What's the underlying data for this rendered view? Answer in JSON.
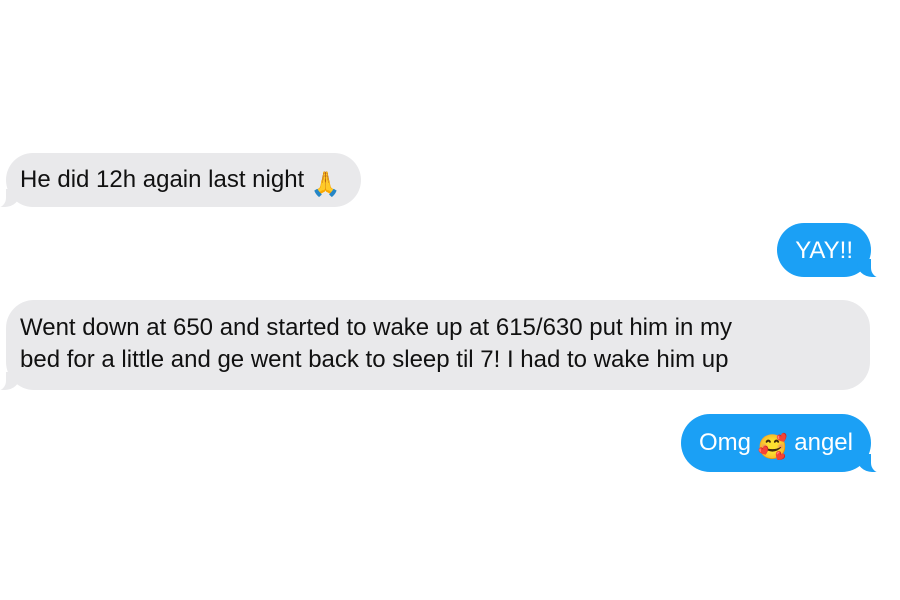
{
  "messages": [
    {
      "direction": "incoming",
      "text": "He did 12h again last night",
      "emoji": "🙏",
      "emoji_name": "folded-hands-icon"
    },
    {
      "direction": "outgoing",
      "text": "YAY!!"
    },
    {
      "direction": "incoming",
      "line1": "Went down at 650 and started to wake up at 615/630 put him in my",
      "line2": "bed for a little and ge went back to sleep til 7! I had to wake him up"
    },
    {
      "direction": "outgoing",
      "before": "Omg",
      "emoji": "🥰",
      "emoji_name": "smiling-face-with-hearts-icon",
      "after": "angel"
    }
  ],
  "colors": {
    "incoming_bubble": "#e9e9eb",
    "outgoing_bubble": "#1ba0f5",
    "incoming_text": "#111111",
    "outgoing_text": "#ffffff"
  }
}
